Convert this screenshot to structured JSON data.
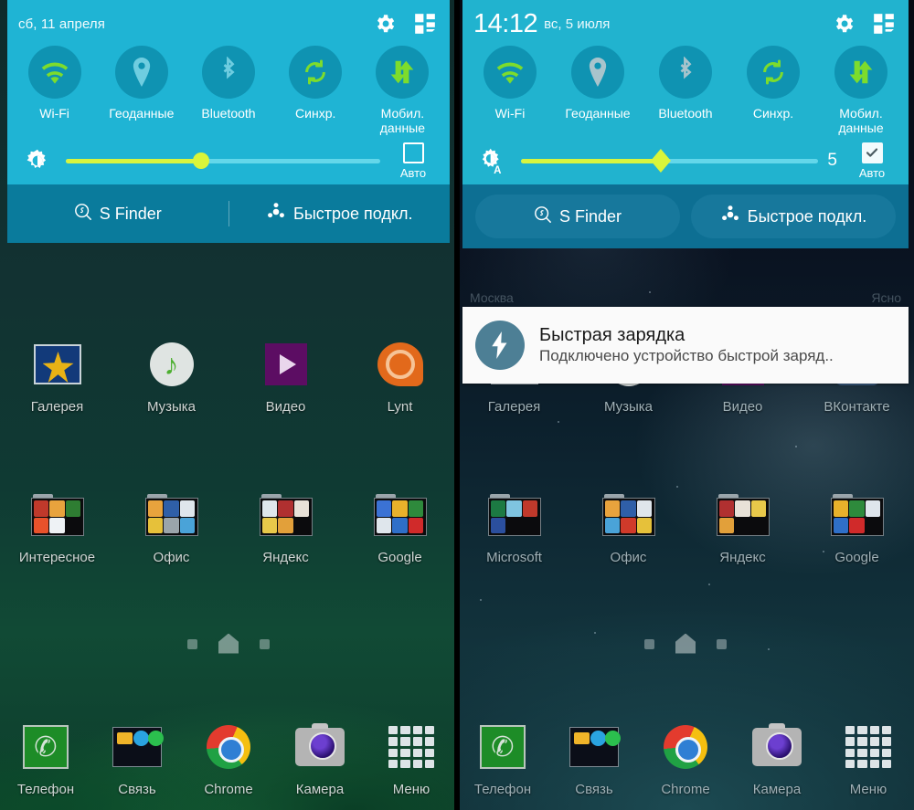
{
  "left_screen": {
    "quick_settings": {
      "date": "сб, 11 апреля",
      "settings_icon": "gear-icon",
      "edit_icon": "quick-settings-grid-icon",
      "toggles": [
        {
          "label": "Wi-Fi",
          "icon": "wifi-icon",
          "active": true
        },
        {
          "label": "Геоданные",
          "icon": "location-pin-icon",
          "active": false
        },
        {
          "label": "Bluetooth",
          "icon": "bluetooth-icon",
          "active": false
        },
        {
          "label": "Синхр.",
          "icon": "sync-icon",
          "active": true
        },
        {
          "label": "Мобил. данные",
          "icon": "mobile-data-icon",
          "active": true
        }
      ],
      "brightness": {
        "icon": "brightness-icon",
        "percent": 43,
        "value": "",
        "auto_label": "Авто",
        "auto_checked": false
      },
      "buttons": [
        {
          "label": "S Finder",
          "icon": "s-finder-icon"
        },
        {
          "label": "Быстрое подкл.",
          "icon": "quick-connect-icon"
        }
      ]
    },
    "apps_row": [
      {
        "label": "Галерея",
        "icon": "gallery-icon"
      },
      {
        "label": "Музыка",
        "icon": "music-icon"
      },
      {
        "label": "Видео",
        "icon": "video-icon"
      },
      {
        "label": "Lynt",
        "icon": "lynt-icon"
      }
    ],
    "folders_row": [
      {
        "label": "Интересное",
        "icon": "folder-icon"
      },
      {
        "label": "Офис",
        "icon": "folder-icon"
      },
      {
        "label": "Яндекс",
        "icon": "folder-icon"
      },
      {
        "label": "Google",
        "icon": "folder-icon"
      }
    ],
    "dock": [
      {
        "label": "Телефон",
        "icon": "phone-icon"
      },
      {
        "label": "Связь",
        "icon": "communication-folder-icon"
      },
      {
        "label": "Chrome",
        "icon": "chrome-icon"
      },
      {
        "label": "Камера",
        "icon": "camera-icon"
      },
      {
        "label": "Меню",
        "icon": "app-drawer-icon"
      }
    ],
    "page_indicator": {
      "pages": 3,
      "current": 2
    }
  },
  "right_screen": {
    "quick_settings": {
      "time": "14:12",
      "date": "вс, 5 июля",
      "settings_icon": "gear-icon",
      "edit_icon": "quick-settings-grid-icon",
      "toggles": [
        {
          "label": "Wi-Fi",
          "icon": "wifi-icon",
          "active": true
        },
        {
          "label": "Геоданные",
          "icon": "location-pin-icon",
          "active": false
        },
        {
          "label": "Bluetooth",
          "icon": "bluetooth-icon",
          "active": false
        },
        {
          "label": "Синхр.",
          "icon": "sync-icon",
          "active": true
        },
        {
          "label": "Мобил. данные",
          "icon": "mobile-data-icon",
          "active": true
        }
      ],
      "brightness": {
        "icon": "brightness-auto-icon",
        "percent": 47,
        "value": "5",
        "auto_label": "Авто",
        "auto_checked": true
      },
      "buttons": [
        {
          "label": "S Finder",
          "icon": "s-finder-icon"
        },
        {
          "label": "Быстрое подкл.",
          "icon": "quick-connect-icon"
        }
      ]
    },
    "notification": {
      "icon": "fast-charging-icon",
      "title": "Быстрая зарядка",
      "subtitle": "Подключено устройство быстрой заряд.."
    },
    "weather_widget": {
      "city": "Москва",
      "condition": "Ясно"
    },
    "apps_row": [
      {
        "label": "Галерея",
        "icon": "gallery-icon"
      },
      {
        "label": "Музыка",
        "icon": "music-icon"
      },
      {
        "label": "Видео",
        "icon": "video-icon"
      },
      {
        "label": "ВКонтакте",
        "icon": "vk-icon"
      }
    ],
    "folders_row": [
      {
        "label": "Microsoft",
        "icon": "folder-icon"
      },
      {
        "label": "Офис",
        "icon": "folder-icon"
      },
      {
        "label": "Яндекс",
        "icon": "folder-icon"
      },
      {
        "label": "Google",
        "icon": "folder-icon"
      }
    ],
    "dock": [
      {
        "label": "Телефон",
        "icon": "phone-icon"
      },
      {
        "label": "Связь",
        "icon": "communication-folder-icon"
      },
      {
        "label": "Chrome",
        "icon": "chrome-icon"
      },
      {
        "label": "Камера",
        "icon": "camera-icon"
      },
      {
        "label": "Меню",
        "icon": "app-drawer-icon"
      }
    ],
    "page_indicator": {
      "pages": 3,
      "current": 2
    }
  },
  "colors": {
    "panel_bg": "#1fb4d4",
    "panel_bg_right": "#21b3cf",
    "panel_footer": "#0a7b9c",
    "toggle_circle": "#0f93b2",
    "toggle_on": "#7ddc2c",
    "toggle_off": "#63c9dd",
    "slider_fill": "#d7f53f",
    "slider_track": "#63d7ea",
    "notification_bg": "#fafafa"
  }
}
